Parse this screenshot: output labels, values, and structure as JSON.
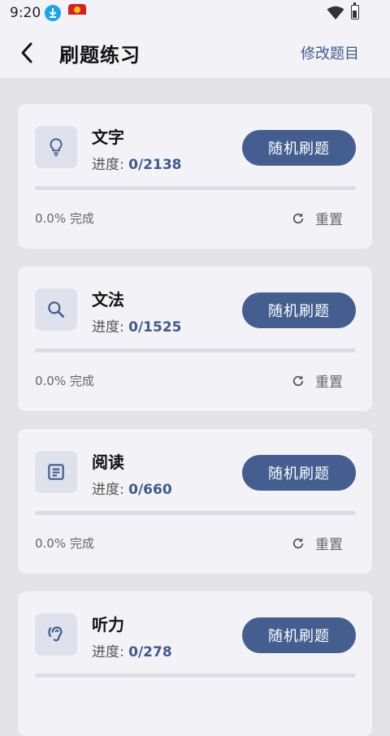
{
  "status_bar": {
    "time": "9:20"
  },
  "header": {
    "title": "刷题练习",
    "edit_label": "修改题目"
  },
  "colors": {
    "accent": "#445f8f",
    "background": "#e3e3e8",
    "card": "#f3f3f7"
  },
  "cards": [
    {
      "title": "文字",
      "icon": "lightbulb-icon",
      "progress_label": "进度:",
      "progress": "0/2138",
      "fraction": 0.0,
      "percent_text": "0.0% 完成",
      "button_label": "随机刷题",
      "reset_label": "重置"
    },
    {
      "title": "文法",
      "icon": "search-icon",
      "progress_label": "进度:",
      "progress": "0/1525",
      "fraction": 0.0,
      "percent_text": "0.0% 完成",
      "button_label": "随机刷题",
      "reset_label": "重置"
    },
    {
      "title": "阅读",
      "icon": "article-icon",
      "progress_label": "进度:",
      "progress": "0/660",
      "fraction": 0.0,
      "percent_text": "0.0% 完成",
      "button_label": "随机刷题",
      "reset_label": "重置"
    },
    {
      "title": "听力",
      "icon": "hearing-icon",
      "progress_label": "进度:",
      "progress": "0/278",
      "fraction": 0.0,
      "percent_text": "",
      "button_label": "随机刷题",
      "reset_label": ""
    }
  ]
}
